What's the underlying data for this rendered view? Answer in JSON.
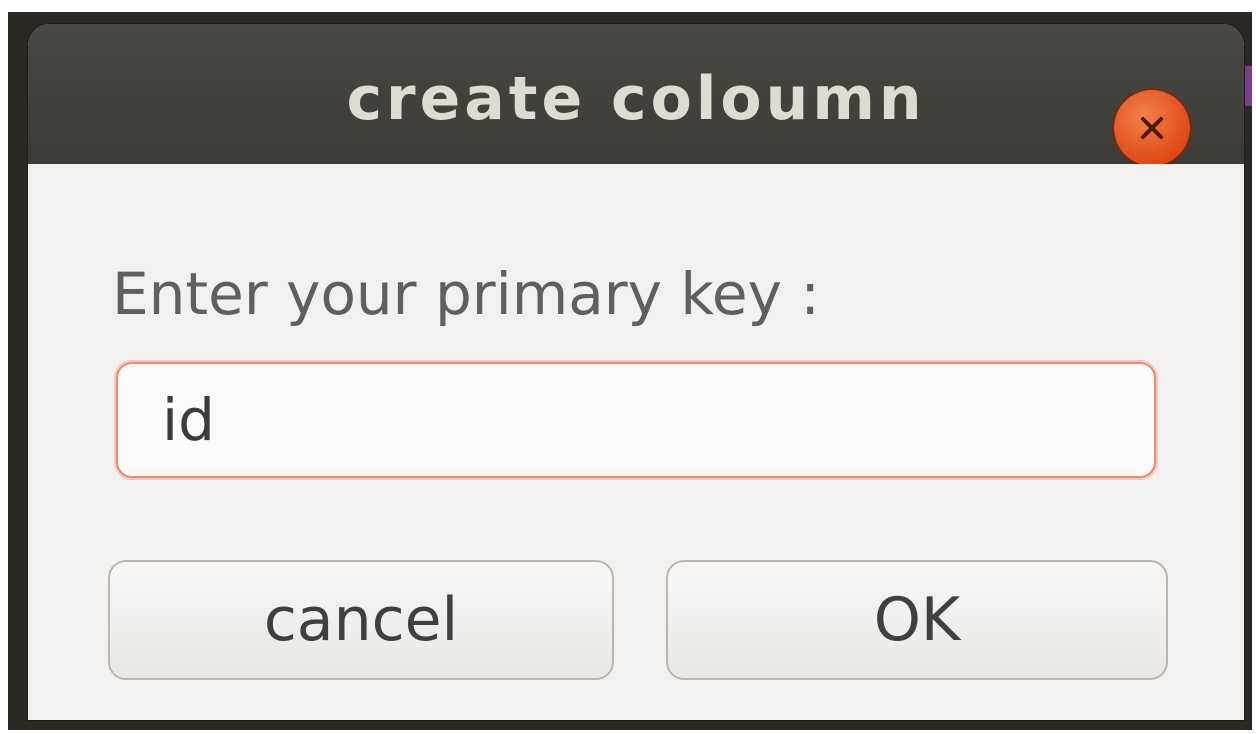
{
  "dialog": {
    "title": "create coloumn",
    "close_icon": "close-icon"
  },
  "form": {
    "prompt_label": "Enter your primary key :",
    "primary_key_value": "id"
  },
  "buttons": {
    "cancel_label": "cancel",
    "ok_label": "OK"
  },
  "colors": {
    "titlebar": "#3c3b37",
    "title_text": "#dfdbd2",
    "close_button": "#df4a16",
    "field_focus_border": "#ee8b6f",
    "dialog_background": "#f2f1f0"
  }
}
